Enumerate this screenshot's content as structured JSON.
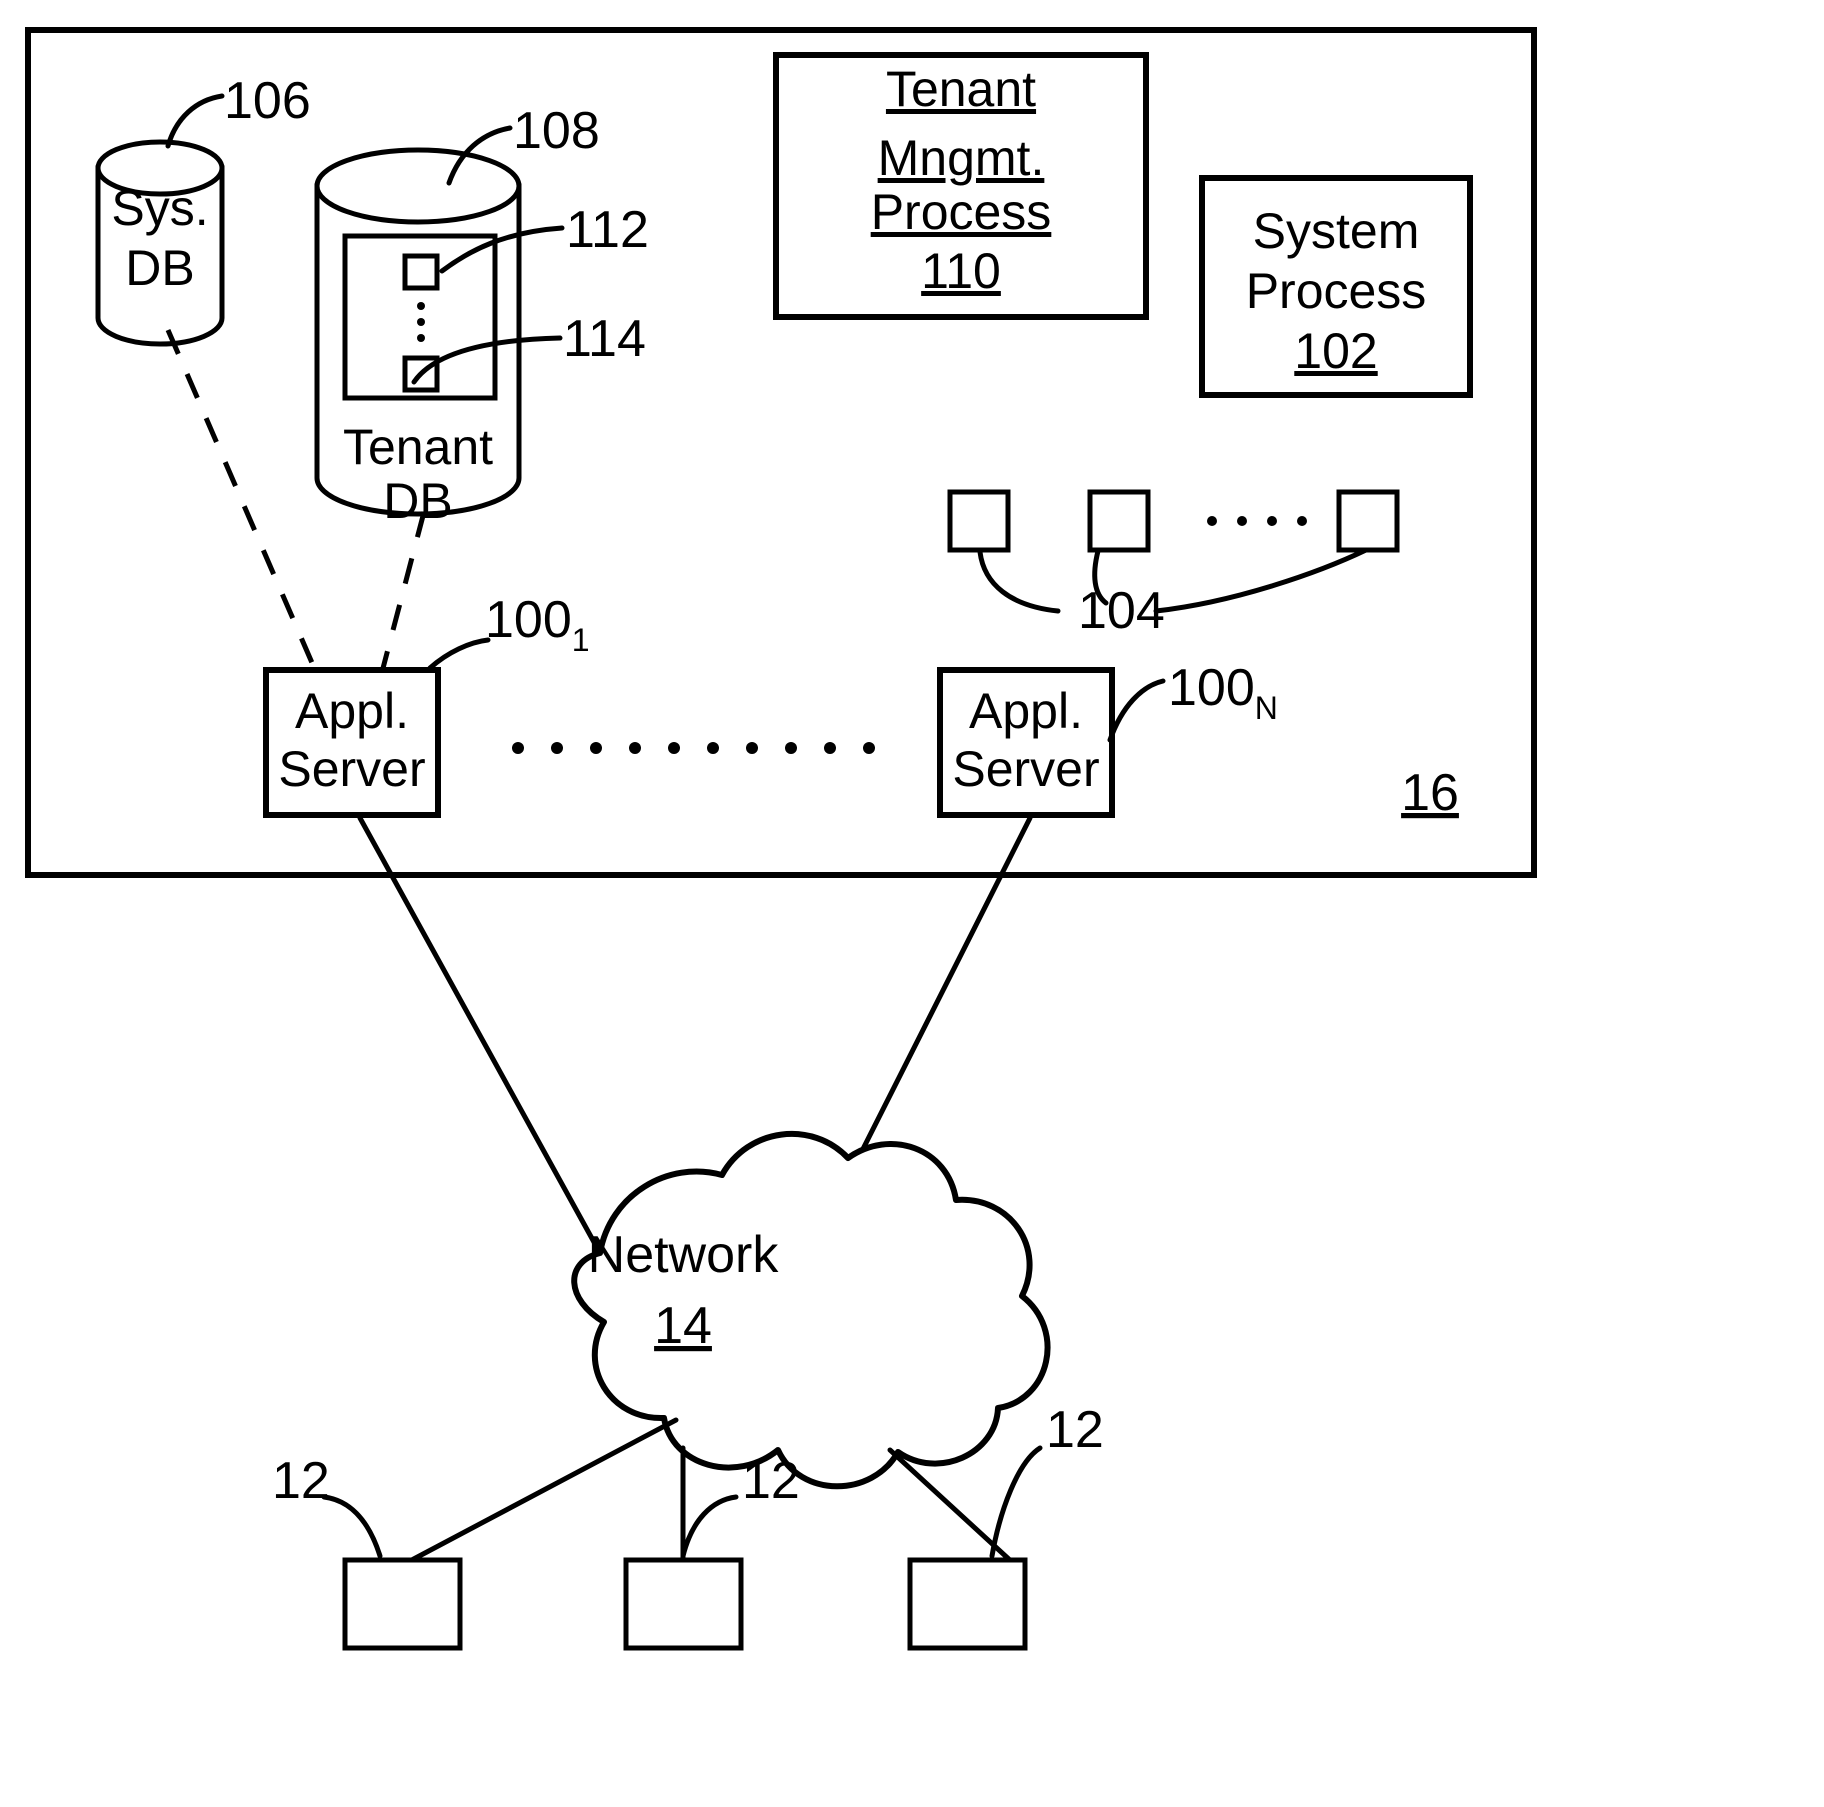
{
  "figure": {
    "title": "Multi-tenant system architecture diagram",
    "ink_color": "#000000",
    "background_color": "#ffffff"
  },
  "system_boundary": {
    "label": "16",
    "underlined": true
  },
  "databases": [
    {
      "name": "sys-db",
      "line1": "Sys.",
      "line2": "DB",
      "ref": "106"
    },
    {
      "name": "tenant-db",
      "line1": "Tenant",
      "line2": "DB",
      "ref": "108"
    }
  ],
  "tenant_db_inner": {
    "top_square_ref": "112",
    "bottom_square_ref": "114",
    "vertical_ellipsis": "..."
  },
  "process_boxes": [
    {
      "name": "tenant-management-process",
      "lines": [
        "Tenant",
        "Mngmt.",
        "Process"
      ],
      "ref": "110",
      "all_underlined": true
    },
    {
      "name": "system-process",
      "lines": [
        "System",
        "Process"
      ],
      "ref": "102",
      "all_underlined": false
    }
  ],
  "process_space": {
    "ref": "104",
    "ellipsis": "...."
  },
  "app_servers": [
    {
      "name": "app-server-1",
      "line1": "Appl.",
      "line2": "Server",
      "ref_base": "100",
      "ref_sub": "1"
    },
    {
      "name": "app-server-n",
      "line1": "Appl.",
      "line2": "Server",
      "ref_base": "100",
      "ref_sub": "N"
    }
  ],
  "server_row_ellipsis": ". . . . . . . . . .",
  "network": {
    "label": "Network",
    "ref": "14",
    "ref_underlined": true
  },
  "user_systems": [
    {
      "name": "user-system-left",
      "ref": "12"
    },
    {
      "name": "user-system-center",
      "ref": "12"
    },
    {
      "name": "user-system-right",
      "ref": "12"
    }
  ]
}
